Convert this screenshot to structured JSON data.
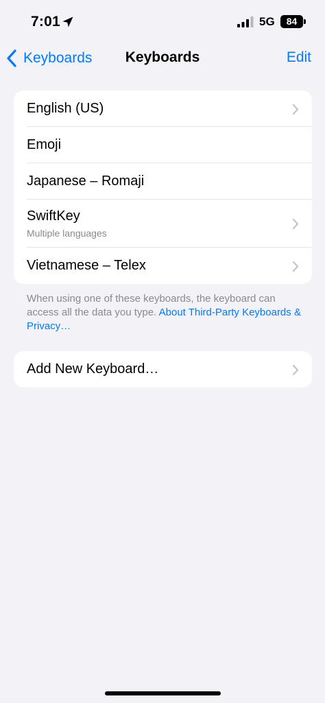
{
  "status_bar": {
    "time": "7:01",
    "network": "5G",
    "battery": "84"
  },
  "nav": {
    "back_label": "Keyboards",
    "title": "Keyboards",
    "edit_label": "Edit"
  },
  "keyboards": {
    "items": [
      {
        "label": "English (US)",
        "subtitle": "",
        "chevron": true
      },
      {
        "label": "Emoji",
        "subtitle": "",
        "chevron": false
      },
      {
        "label": "Japanese – Romaji",
        "subtitle": "",
        "chevron": false
      },
      {
        "label": "SwiftKey",
        "subtitle": "Multiple languages",
        "chevron": true
      },
      {
        "label": "Vietnamese – Telex",
        "subtitle": "",
        "chevron": true
      }
    ],
    "footer_text": "When using one of these keyboards, the keyboard can access all the data you type. ",
    "footer_link": "About Third-Party Keyboards & Privacy…"
  },
  "add_keyboard": {
    "label": "Add New Keyboard…"
  },
  "colors": {
    "accent": "#007aff",
    "background": "#f2f2f7",
    "secondary_text": "#8a8a8e",
    "chevron": "#c4c4c7"
  },
  "icons": {
    "location": "location-arrow-icon",
    "signal": "cellular-signal-icon",
    "back": "chevron-left-icon",
    "disclosure": "chevron-right-icon"
  }
}
